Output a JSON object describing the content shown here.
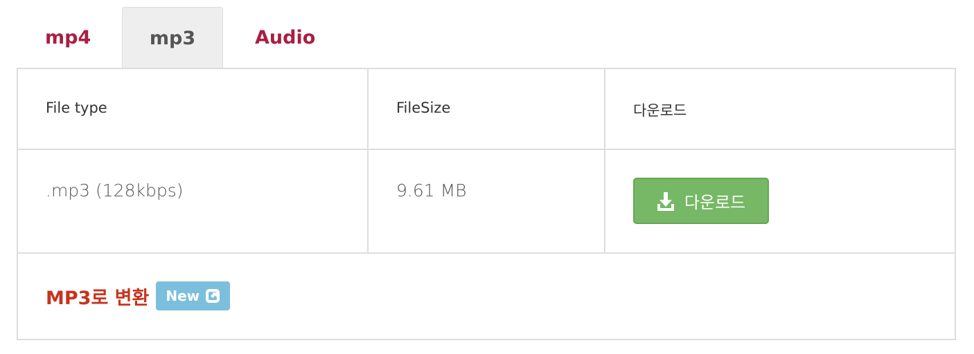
{
  "tabs": [
    {
      "label": "mp4",
      "active": false
    },
    {
      "label": "mp3",
      "active": true
    },
    {
      "label": "Audio",
      "active": false
    }
  ],
  "table": {
    "headers": [
      "File type",
      "FileSize",
      "다운로드"
    ],
    "rows": [
      {
        "file_type": ".mp3 (128kbps)",
        "file_size": "9.61 MB",
        "button_label": "다운로드"
      }
    ],
    "footer": {
      "link_text": "MP3로 변환",
      "badge_text": "New"
    }
  },
  "colors": {
    "tab_link": "#a91e45",
    "download_button": "#76b865",
    "footer_link": "#c8331e",
    "badge": "#7bbfdd"
  },
  "icons": {
    "download": "download-icon",
    "external_link": "external-link-icon"
  }
}
